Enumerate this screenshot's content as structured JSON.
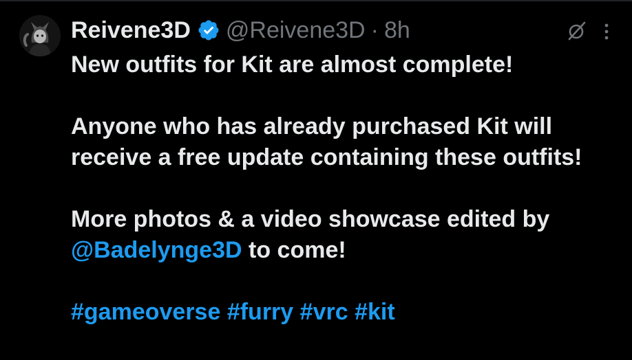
{
  "tweet": {
    "author": {
      "display_name": "Reivene3D",
      "handle": "@Reivene3D",
      "verified": true,
      "avatar_icon": "avatar-image"
    },
    "separator": "·",
    "time": "8h",
    "icons": {
      "grok": "grok-icon",
      "more": "more-options-icon"
    },
    "text": {
      "line1": "New outfits for Kit are almost complete!",
      "para2": "Anyone who has already purchased Kit will receive a free update containing these outfits!",
      "para3_prefix": "More photos & a video showcase edited by",
      "mention": "@Badelynge3D",
      "para3_suffix": " to come!",
      "hashtags": [
        "#gameoverse",
        "#furry",
        "#vrc",
        "#kit"
      ]
    }
  },
  "colors": {
    "background": "#000000",
    "text": "#e7e9ea",
    "secondary": "#71767b",
    "link": "#1d9bf0",
    "verified_badge": "#1d9bf0"
  }
}
